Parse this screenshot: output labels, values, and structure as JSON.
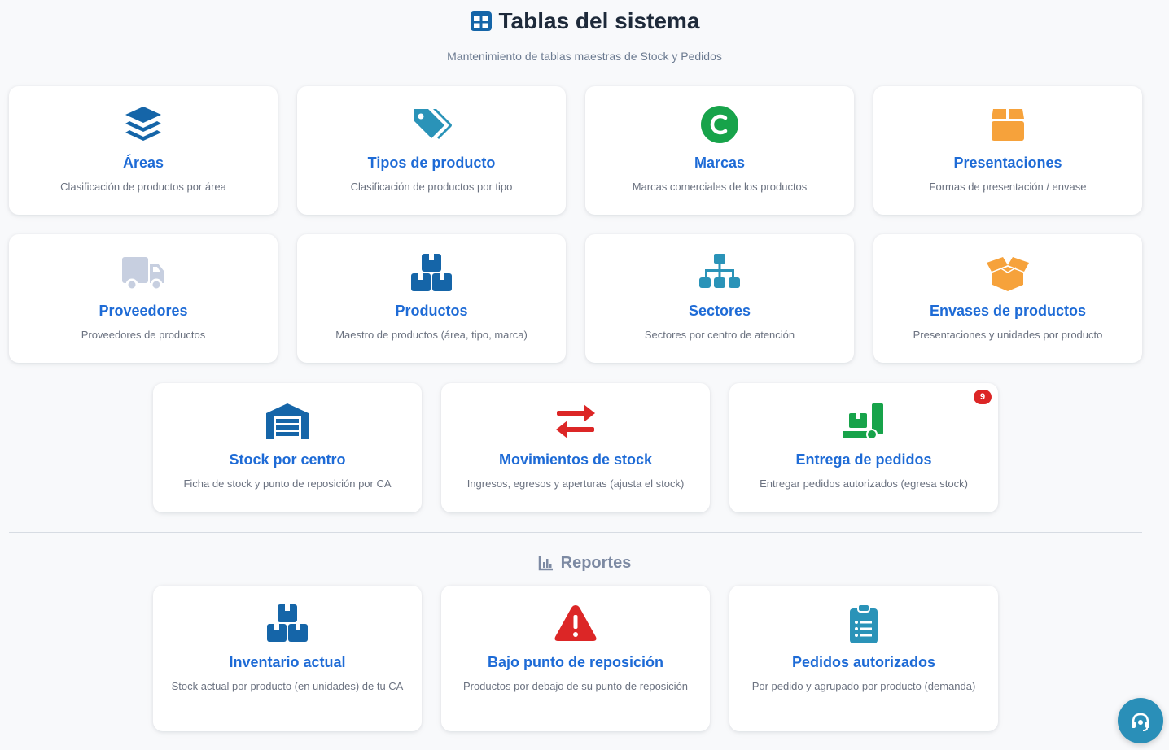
{
  "header": {
    "title": "Tablas del sistema",
    "subtitle": "Mantenimiento de tablas maestras de Stock y Pedidos"
  },
  "cards": [
    {
      "title": "Áreas",
      "desc": "Clasificación de productos por área",
      "icon": "layer-group-icon",
      "color": "#1565a8"
    },
    {
      "title": "Tipos de producto",
      "desc": "Clasificación de productos por tipo",
      "icon": "tags-icon",
      "color": "#2a93b8"
    },
    {
      "title": "Marcas",
      "desc": "Marcas comerciales de los productos",
      "icon": "copyright-icon",
      "color": "#17a34a"
    },
    {
      "title": "Presentaciones",
      "desc": "Formas de presentación / envase",
      "icon": "box-icon",
      "color": "#f6a23b"
    },
    {
      "title": "Proveedores",
      "desc": "Proveedores de productos",
      "icon": "truck-icon",
      "color": "#c7cfe0"
    },
    {
      "title": "Productos",
      "desc": "Maestro de productos (área, tipo, marca)",
      "icon": "boxes-icon",
      "color": "#1565a8"
    },
    {
      "title": "Sectores",
      "desc": "Sectores por centro de atención",
      "icon": "sitemap-icon",
      "color": "#2a93b8"
    },
    {
      "title": "Envases de productos",
      "desc": "Presentaciones y unidades por producto",
      "icon": "box-open-icon",
      "color": "#f6a23b"
    },
    {
      "title": "Stock por centro",
      "desc": "Ficha de stock y punto de reposición por CA",
      "icon": "warehouse-icon",
      "color": "#1565a8"
    },
    {
      "title": "Movimientos de stock",
      "desc": "Ingresos, egresos y aperturas (ajusta el stock)",
      "icon": "exchange-icon",
      "color": "#dc2626"
    },
    {
      "title": "Entrega de pedidos",
      "desc": "Entregar pedidos autorizados (egresa stock)",
      "icon": "dolly-icon",
      "color": "#17a34a",
      "badge": "9"
    }
  ],
  "reports": {
    "title": "Reportes",
    "icon": "chart-bar-icon",
    "items": [
      {
        "title": "Inventario actual",
        "desc": "Stock actual por producto (en unidades) de tu CA",
        "icon": "boxes-icon",
        "color": "#1565a8"
      },
      {
        "title": "Bajo punto de reposición",
        "desc": "Productos por debajo de su punto de reposición",
        "icon": "warning-icon",
        "color": "#dc2626"
      },
      {
        "title": "Pedidos autorizados",
        "desc": "Por pedido y agrupado por producto (demanda)",
        "icon": "clipboard-list-icon",
        "color": "#2a93b8"
      }
    ]
  },
  "help": {
    "icon": "headset-icon"
  }
}
